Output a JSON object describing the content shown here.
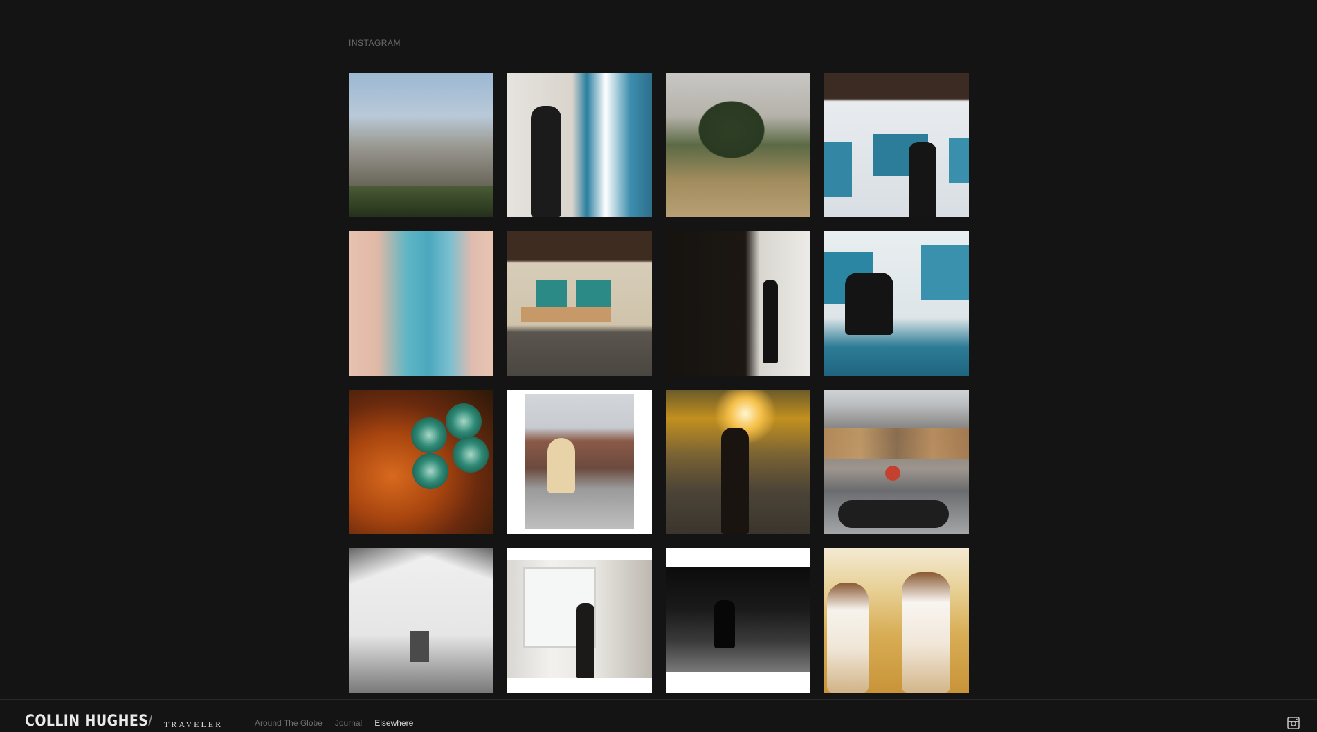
{
  "section": {
    "title": "INSTAGRAM"
  },
  "instagram_grid": {
    "items": [
      {
        "icon": "city-aerial-photo"
      },
      {
        "icon": "artist-painting-photo"
      },
      {
        "icon": "hillside-trees-photo"
      },
      {
        "icon": "studio-painting-photo"
      },
      {
        "icon": "abstract-paint-photo"
      },
      {
        "icon": "studio-table-photo"
      },
      {
        "icon": "doorway-man-photo"
      },
      {
        "icon": "artist-working-photo"
      },
      {
        "icon": "spray-cans-photo"
      },
      {
        "icon": "street-children-photo"
      },
      {
        "icon": "sunset-street-photo"
      },
      {
        "icon": "graffiti-wall-photo"
      },
      {
        "icon": "bw-wall-photo"
      },
      {
        "icon": "window-studio-photo"
      },
      {
        "icon": "night-cyclist-photo"
      },
      {
        "icon": "two-women-photo"
      }
    ]
  },
  "footer": {
    "brand": "COLLIN HUGHES",
    "separator": "/",
    "subtitle": "TRAVELER",
    "nav": [
      {
        "label": "Around The Globe",
        "active": false
      },
      {
        "label": "Journal",
        "active": false
      },
      {
        "label": "Elsewhere",
        "active": true
      }
    ],
    "social_icon": "instagram-icon"
  },
  "colors": {
    "background": "#141414",
    "text_muted": "#6f6f6f",
    "text_active": "#d9d9d9",
    "brand_text": "#eaeaea"
  }
}
